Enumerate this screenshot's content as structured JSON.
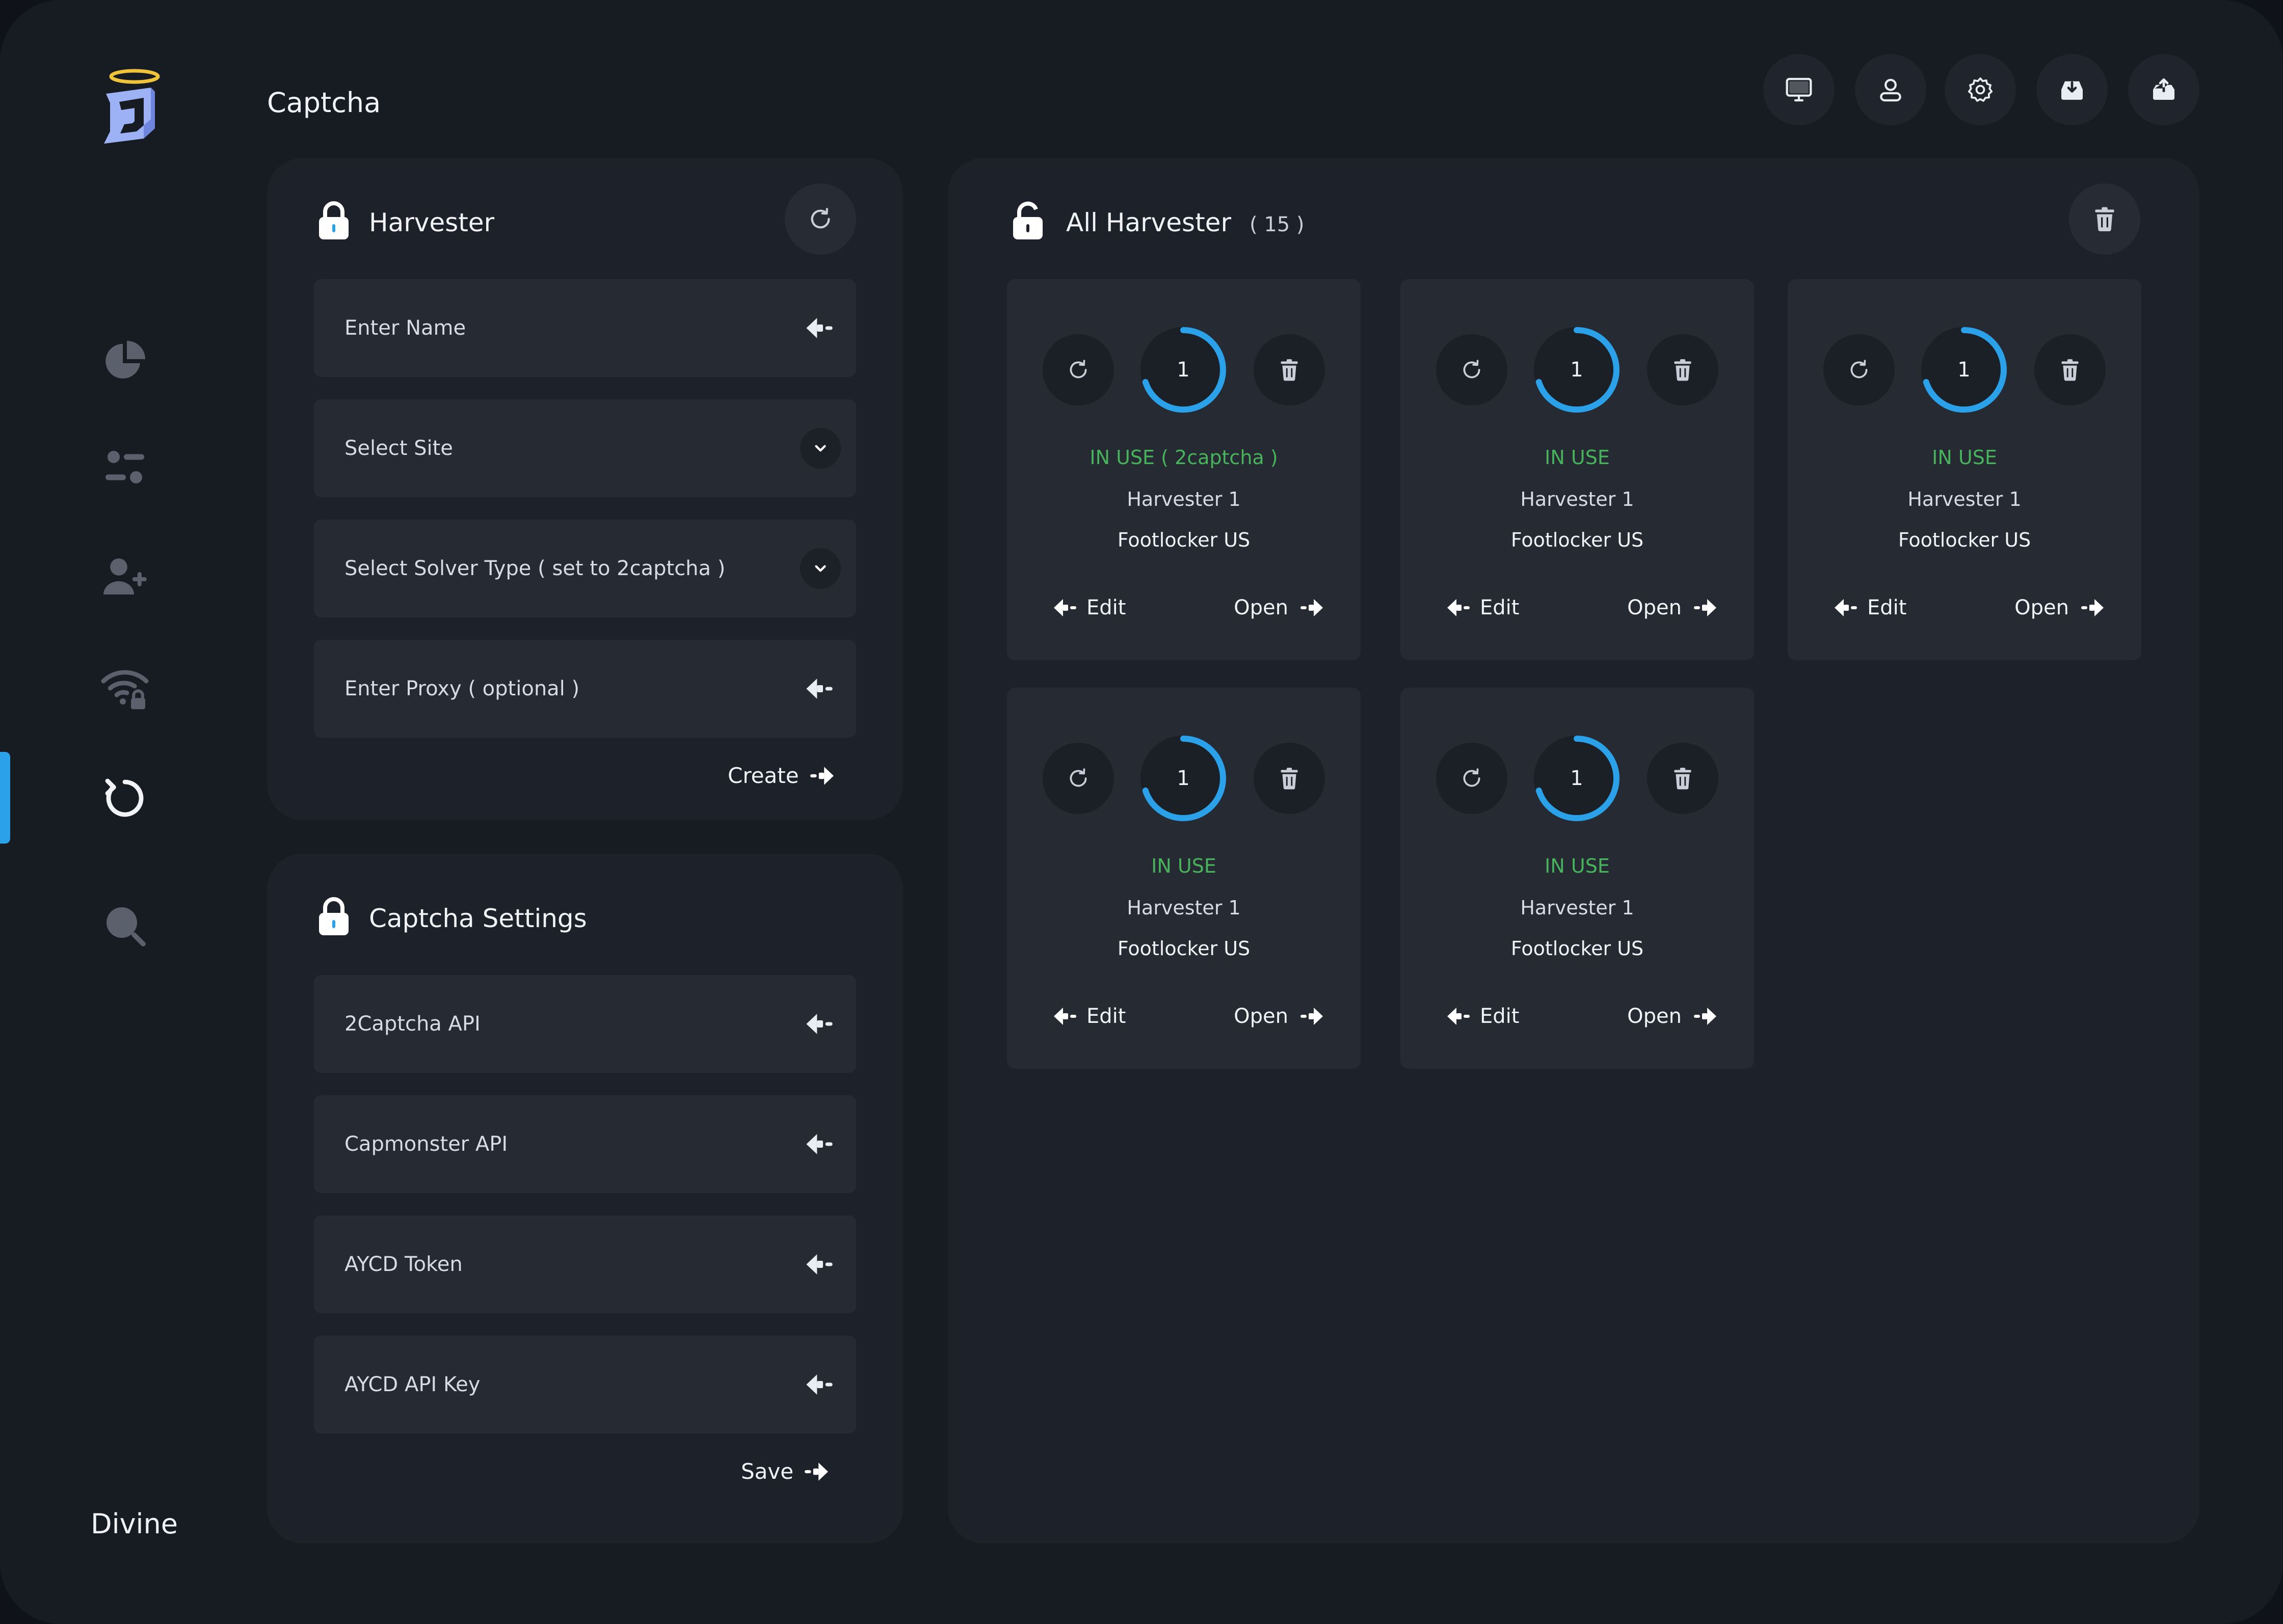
{
  "app": {
    "brand": "Divine",
    "page_title": "Captcha"
  },
  "sidebar": {
    "items": [
      {
        "name": "dashboard",
        "icon": "pie-chart-icon",
        "active": false
      },
      {
        "name": "tasks",
        "icon": "sliders-icon",
        "active": false
      },
      {
        "name": "profiles",
        "icon": "add-user-icon",
        "active": false
      },
      {
        "name": "proxies",
        "icon": "wifi-lock-icon",
        "active": false
      },
      {
        "name": "captcha",
        "icon": "refresh-icon",
        "active": true
      },
      {
        "name": "search",
        "icon": "search-icon",
        "active": false
      }
    ]
  },
  "topbar": {
    "icons": [
      "monitor-icon",
      "user-icon",
      "gear-icon",
      "download-icon",
      "upload-icon"
    ]
  },
  "harvester_form": {
    "title": "Harvester",
    "name_placeholder": "Enter Name",
    "site_placeholder": "Select Site",
    "solver_placeholder": "Select Solver Type ( set to 2captcha )",
    "proxy_placeholder": "Enter Proxy ( optional )",
    "create_label": "Create"
  },
  "captcha_settings": {
    "title": "Captcha Settings",
    "twocaptcha_label": "2Captcha API",
    "capmonster_label": "Capmonster API",
    "aycd_token_label": "AYCD Token",
    "aycd_key_label": "AYCD API Key",
    "save_label": "Save"
  },
  "all_harvester": {
    "title": "All Harvester",
    "count": "( 15 )",
    "cards": [
      {
        "number": "1",
        "status": "IN USE ( 2captcha )",
        "name": "Harvester 1",
        "site": "Footlocker US",
        "edit": "Edit",
        "open": "Open",
        "progress": 0.7
      },
      {
        "number": "1",
        "status": "IN USE",
        "name": "Harvester 1",
        "site": "Footlocker US",
        "edit": "Edit",
        "open": "Open",
        "progress": 0.7
      },
      {
        "number": "1",
        "status": "IN USE",
        "name": "Harvester 1",
        "site": "Footlocker US",
        "edit": "Edit",
        "open": "Open",
        "progress": 0.7
      },
      {
        "number": "1",
        "status": "IN USE",
        "name": "Harvester 1",
        "site": "Footlocker US",
        "edit": "Edit",
        "open": "Open",
        "progress": 0.7
      },
      {
        "number": "1",
        "status": "IN USE",
        "name": "Harvester 1",
        "site": "Footlocker US",
        "edit": "Edit",
        "open": "Open",
        "progress": 0.7
      }
    ]
  },
  "colors": {
    "accent": "#2aa1e8",
    "status_green": "#47b35a",
    "background": "#171b22",
    "panel": "#1d2129"
  }
}
